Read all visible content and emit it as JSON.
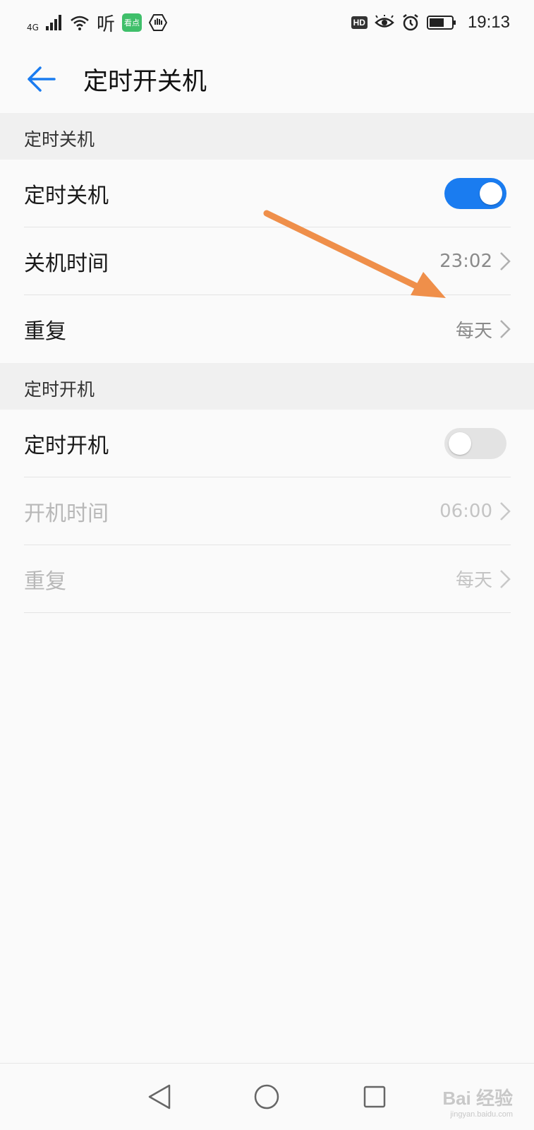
{
  "status_bar": {
    "network": "4G",
    "ting_label": "听",
    "kandian_label": "看点",
    "hd_label": "HD",
    "time": "19:13"
  },
  "app_bar": {
    "title": "定时开关机"
  },
  "shutdown_section": {
    "header": "定时关机",
    "toggle_label": "定时关机",
    "toggle_on": true,
    "time_label": "关机时间",
    "time_value": "23:02",
    "repeat_label": "重复",
    "repeat_value": "每天"
  },
  "boot_section": {
    "header": "定时开机",
    "toggle_label": "定时开机",
    "toggle_on": false,
    "time_label": "开机时间",
    "time_value": "06:00",
    "repeat_label": "重复",
    "repeat_value": "每天"
  },
  "colors": {
    "accent": "#1a7cf0",
    "toggle_off": "#e3e3e3",
    "annotation_arrow": "#ef8f4a"
  },
  "watermark": {
    "main": "Bai 经验",
    "sub": "jingyan.baidu.com"
  }
}
